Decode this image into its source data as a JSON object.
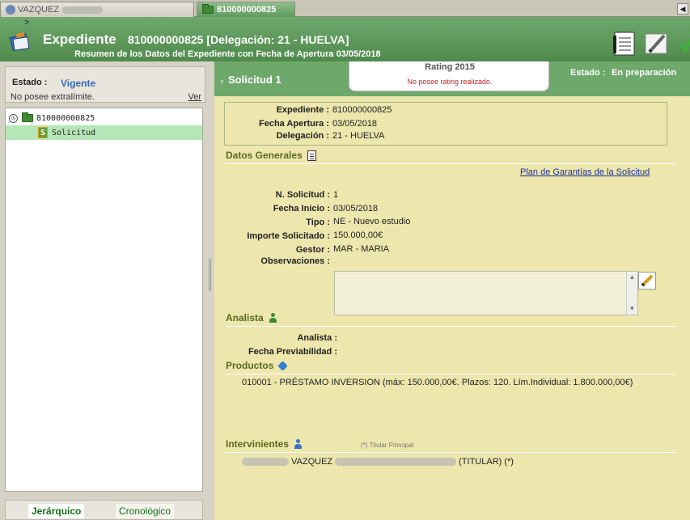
{
  "tabs": [
    {
      "label": "VAZQUEZ"
    },
    {
      "label": "810000000825"
    }
  ],
  "header": {
    "caret": ">",
    "title": "Expediente",
    "subtitle": "810000000825 [Delegación: 21 - HUELVA]",
    "summary": "Resumen de los Datos del Expediente con Fecha de Apertura 03/05/2018"
  },
  "left": {
    "estado_label": "Estado :",
    "estado_value": "Vigente",
    "extralimite": "No posee extralímite.",
    "ver_link": "Ver",
    "tree": {
      "root": "810000000825",
      "child": "Solicitud"
    },
    "tabs": [
      "Jerárquico",
      "Cronológico"
    ]
  },
  "right": {
    "solicitud_tab": "Solicitud 1",
    "rating_title": "Rating 2015",
    "rating_value": "No posee rating realizado.",
    "estado_label": "Estado :",
    "estado_value": "En preparación",
    "expediente_box": {
      "expediente_label": "Expediente :",
      "expediente_value": "810000000825",
      "fecha_label": "Fecha Apertura :",
      "fecha_value": "03/05/2018",
      "delegacion_label": "Delegación :",
      "delegacion_value": "21 - HUELVA"
    },
    "datos_generales": {
      "title": "Datos Generales",
      "plan_link": "Plan de Garantías de la Solicitud",
      "n_solicitud_label": "N. Solicitud :",
      "n_solicitud_value": "1",
      "fecha_inicio_label": "Fecha Inicio :",
      "fecha_inicio_value": "03/05/2018",
      "tipo_label": "Tipo :",
      "tipo_value": "NE - Nuevo estudio",
      "importe_label": "Importe Solicitado :",
      "importe_value": "150.000,00€",
      "gestor_label": "Gestor :",
      "gestor_value": "MAR - MARIA",
      "observaciones_label": "Observaciones :"
    },
    "analista": {
      "title": "Analista",
      "analista_label": "Analista :",
      "fecha_prev_label": "Fecha Previabilidad :"
    },
    "productos": {
      "title": "Productos",
      "line": "010001 - PRÉSTAMO INVERSION (máx: 150.000,00€. Plazos: 120. Lím.Individual: 1.800.000,00€)"
    },
    "intervinientes": {
      "title": "Intervinientes",
      "note": "(*) Titular Principal",
      "name": "VAZQUEZ",
      "role": "(TITULAR) (*)"
    }
  }
}
